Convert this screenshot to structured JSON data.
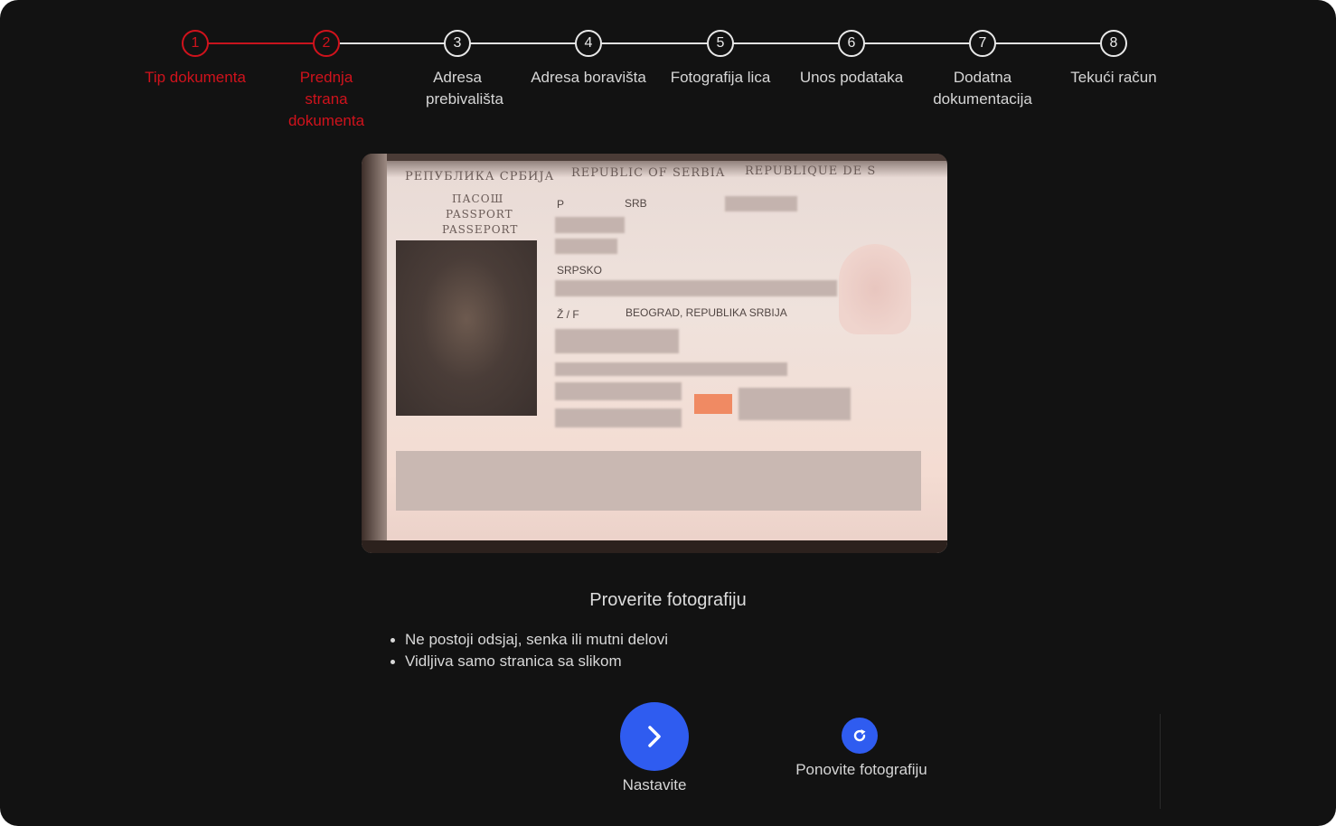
{
  "stepper": {
    "steps": [
      {
        "number": "1",
        "label": "Tip dokumenta",
        "state": "completed"
      },
      {
        "number": "2",
        "label": "Prednja strana dokumenta",
        "state": "active"
      },
      {
        "number": "3",
        "label": "Adresa prebivališta",
        "state": "pending"
      },
      {
        "number": "4",
        "label": "Adresa boravišta",
        "state": "pending"
      },
      {
        "number": "5",
        "label": "Fotografija lica",
        "state": "pending"
      },
      {
        "number": "6",
        "label": "Unos podataka",
        "state": "pending"
      },
      {
        "number": "7",
        "label": "Dodatna dokumentacija",
        "state": "pending"
      },
      {
        "number": "8",
        "label": "Tekući račun",
        "state": "pending"
      }
    ],
    "active_color": "#d0121c",
    "inactive_color": "#e8e8e8"
  },
  "document_photo": {
    "header_cyrillic": "РЕПУБЛИКА СРБИЈА",
    "header_english": "REPUBLIC OF SERBIA",
    "header_french": "REPUBLIQUE DE S",
    "doc_type_lines": [
      "ПАСОШ",
      "PASSPORT",
      "PASSEPORT"
    ],
    "type_value": "P",
    "country_value": "SRB",
    "nationality_value": "SRPSKO",
    "sex_value": "Ž / F",
    "birthplace_value": "BEOGRAD, REPUBLIKA SRBIJA"
  },
  "review": {
    "title": "Proverite fotografiju",
    "tips": [
      "Ne postoji odsjaj, senka ili mutni delovi",
      "Vidljiva samo stranica sa slikom"
    ]
  },
  "actions": {
    "continue_label": "Nastavite",
    "retake_label": "Ponovite fotografiju",
    "button_color": "#2f5cf0"
  }
}
